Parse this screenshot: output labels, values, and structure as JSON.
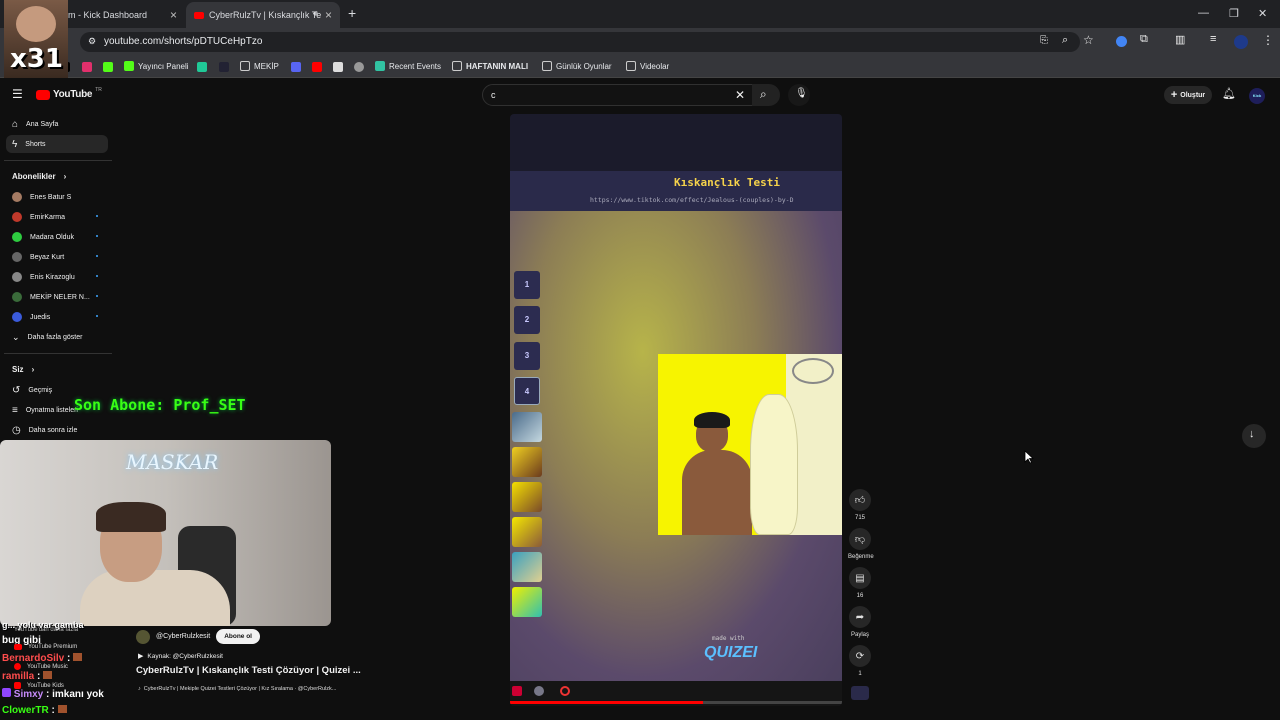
{
  "tabs": [
    {
      "title": "m - Kick Dashboard",
      "active": false
    },
    {
      "title": "CyberRulzTv | Kıskançlık Te",
      "active": true
    }
  ],
  "new_tab": "+",
  "address": "youtube.com/shorts/pDTUCeHpTzo",
  "bookmarks": {
    "yayinci": "Yayıncı Paneli",
    "mekip": "MEKİP",
    "recent": "Recent Events",
    "haftanin": "HAFTANIN MALI",
    "gunluk": "Günlük Oyunlar",
    "videolar": "Videolar"
  },
  "youtube": {
    "logo": "YouTube",
    "logo_sup": "TR",
    "search_value": "c",
    "create_label": "Oluştur",
    "avatar_text": "Kick"
  },
  "sidebar": {
    "home": "Ana Sayfa",
    "shorts": "Shorts",
    "subs_header": "Abonelikler",
    "subscriptions": [
      {
        "name": "Enes Batur S",
        "color": "#a57b63"
      },
      {
        "name": "EmirKarma",
        "color": "#c0392b"
      },
      {
        "name": "Madara Olduk",
        "color": "#2ecc40"
      },
      {
        "name": "Beyaz Kurt",
        "color": "#666666"
      },
      {
        "name": "Enis Kirazoglu",
        "color": "#888888"
      },
      {
        "name": "MEKİP NELER N...",
        "color": "#3a6b3a"
      },
      {
        "name": "Juedis",
        "color": "#3b5bdb"
      }
    ],
    "show_more": "Daha fazla göster",
    "you_header": "Siz",
    "history": "Geçmiş",
    "playlists": "Oynatma listeleri",
    "watch_later": "Daha sonra izle"
  },
  "overlay": {
    "corner_badge": "x31",
    "last_sub": "Son Abone: Prof_SET",
    "cam_sign": "MASKAR"
  },
  "video": {
    "title": "Kıskançlık Testi",
    "url": "https://www.tiktok.com/effect/Jealous-(couples)-by-D",
    "numbers": [
      "1",
      "2",
      "3",
      "4"
    ],
    "made_with": "made with",
    "brand": "QUIZEI"
  },
  "actions": {
    "likes": "715",
    "dislike": "Beğenme",
    "comments": "16",
    "share": "Paylaş",
    "remix": "1"
  },
  "channel": {
    "handle": "@CyberRulzkesit",
    "subscribe": "Abone ol",
    "source": "Kaynak: @CyberRulzkesit",
    "title": "CyberRulzTv | Kıskançlık Testi Çözüyor | Quizei ...",
    "subtitle": "CyberRulzTv | Mekiple Quizei Testleri Çözüyor | Kız Sıralama · @CyberRulzk..."
  },
  "chat": {
    "line0": "g... yolu var gamba",
    "yt_all": "YouTube'dan daha fazla",
    "line1": "bug gibi",
    "yt_premium": "YouTube Premium",
    "user2": "BernardoSilv",
    "msg2": ":",
    "yt_music": "YouTube Music",
    "user3": "ramilla",
    "msg3": ":",
    "yt_kids": "YouTube Kids",
    "user4": "Simxy",
    "msg4": ": imkanı yok",
    "user5": "ClowerTR",
    "msg5": ":"
  },
  "colors": {
    "accent_red": "#ff0000",
    "chat_green": "#39ff14",
    "video_title_yellow": "#f5d24b"
  }
}
